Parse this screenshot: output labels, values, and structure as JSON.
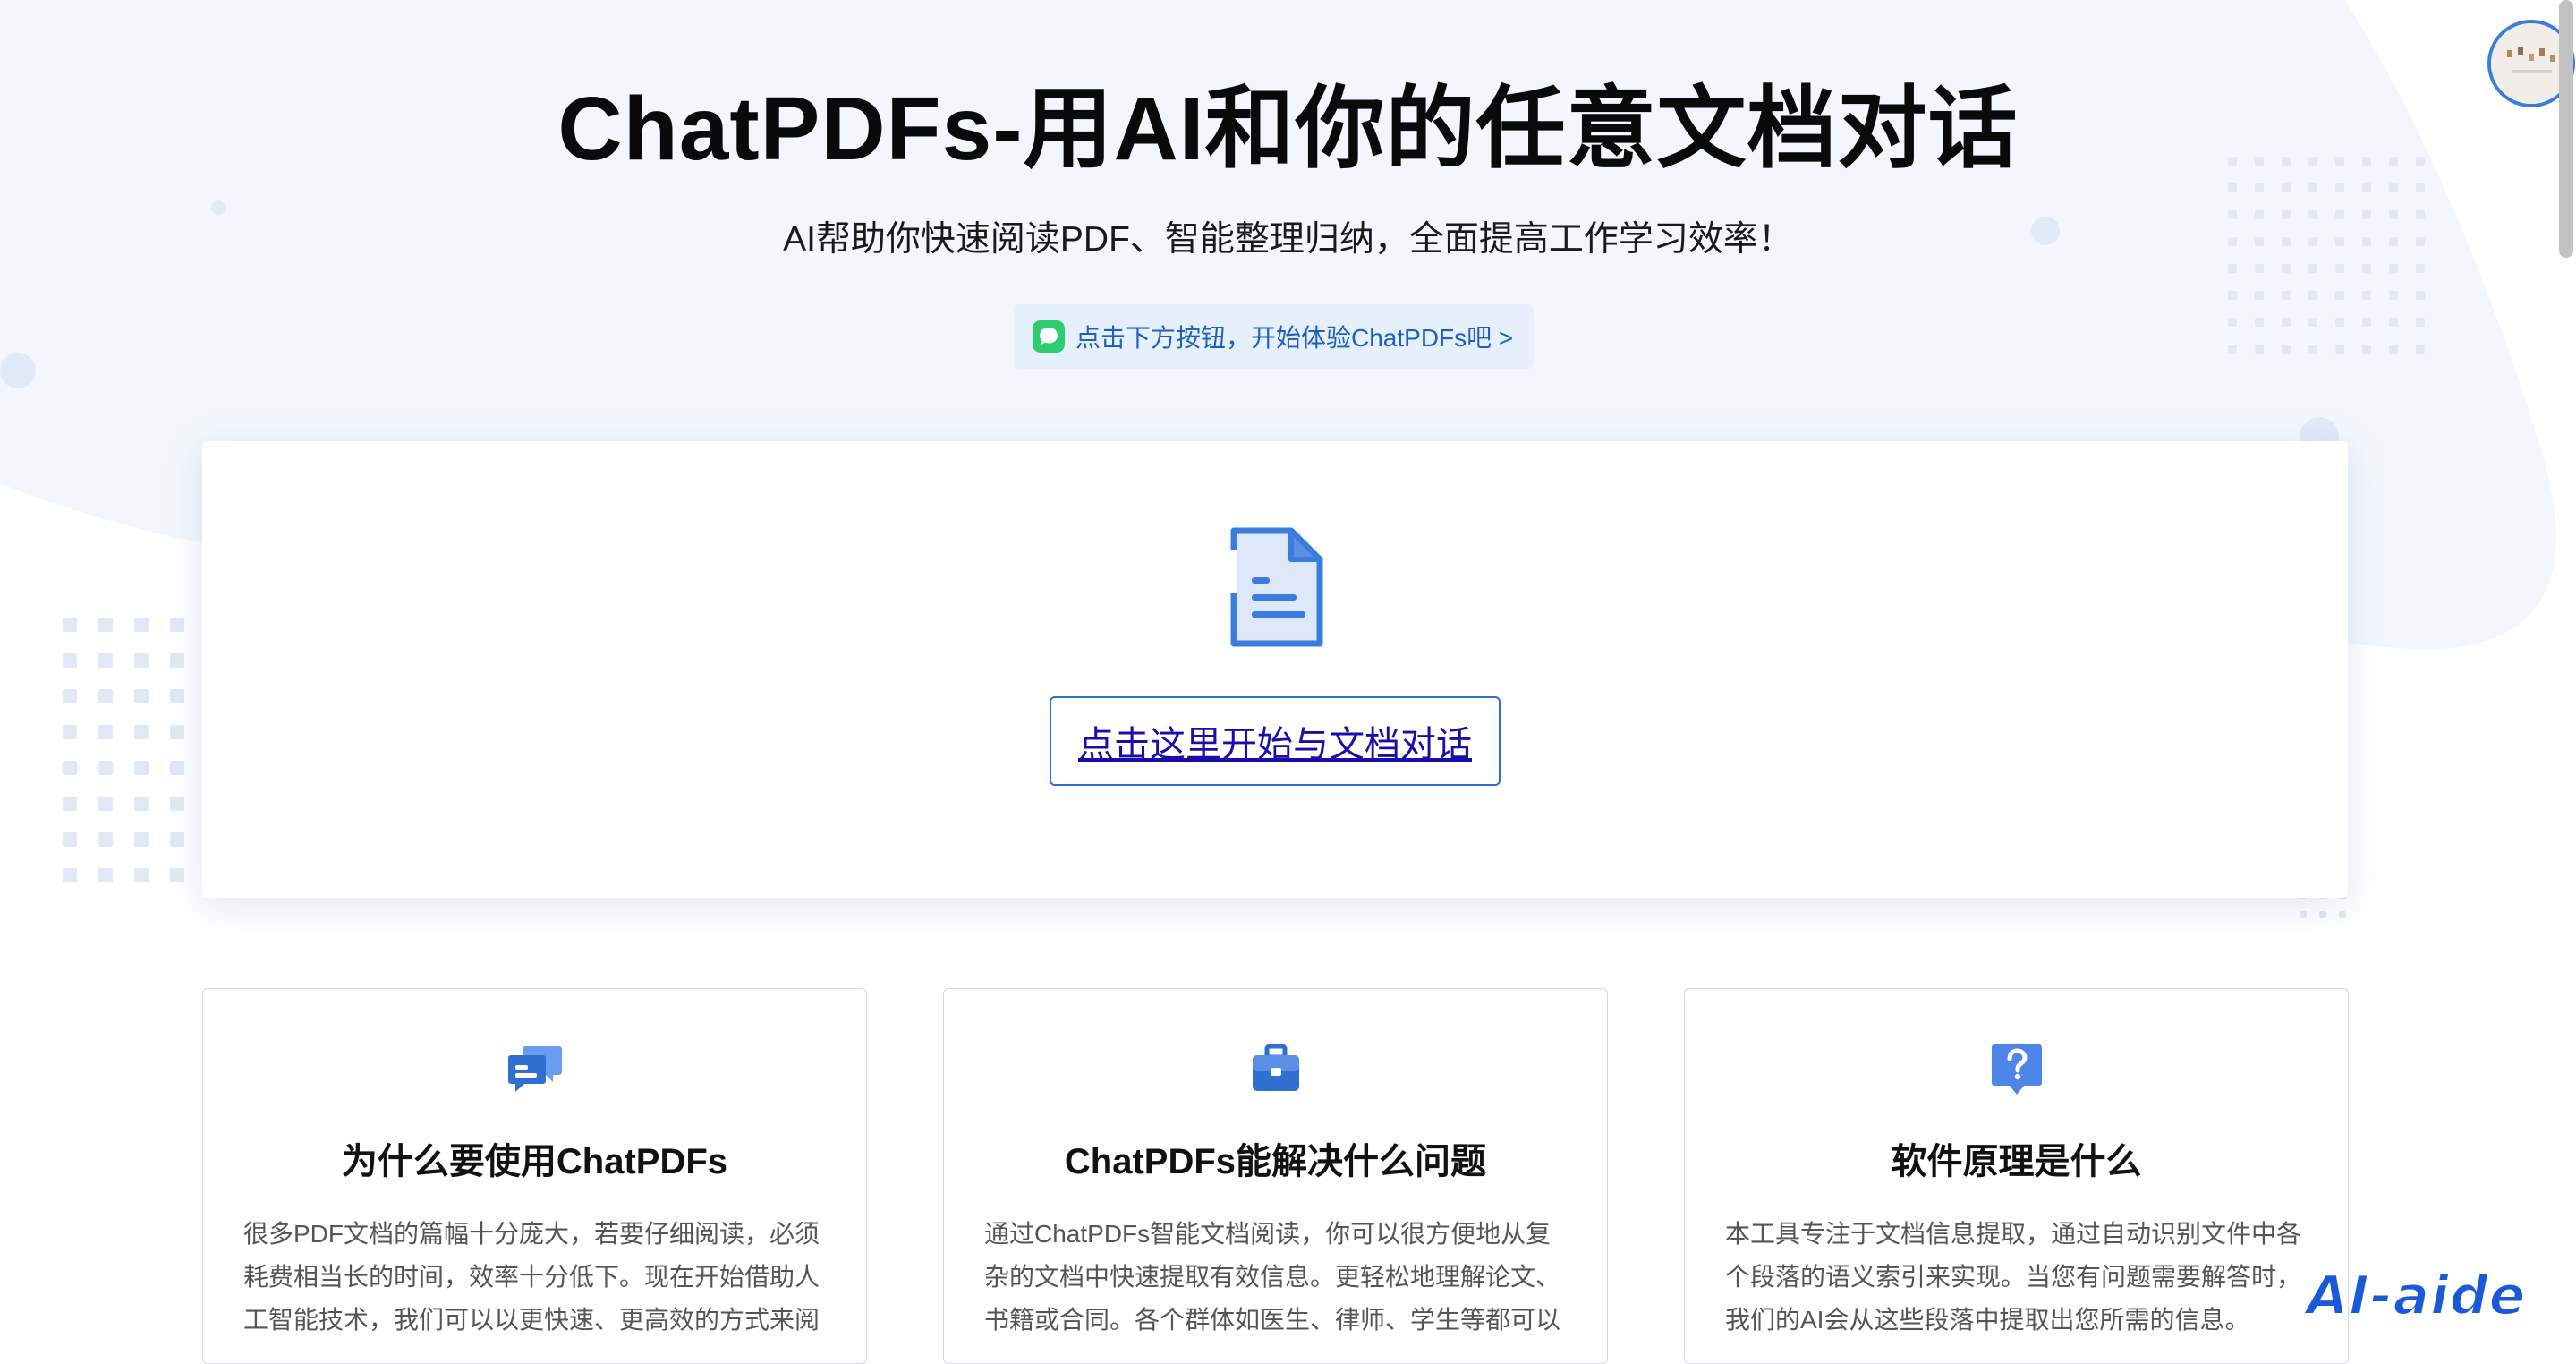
{
  "hero": {
    "title": "ChatPDFs-用AI和你的任意文档对话",
    "subtitle": "AI帮助你快速阅读PDF、智能整理归纳，全面提高工作学习效率！",
    "hint": "点击下方按钮，开始体验ChatPDFs吧 >"
  },
  "upload": {
    "button_label": "点击这里开始与文档对话"
  },
  "features": [
    {
      "icon": "chat-bubbles-icon",
      "title": "为什么要使用ChatPDFs",
      "lines": [
        "很多PDF文档的篇幅十分庞大，若要仔细阅读，必须",
        "耗费相当长的时间，效率十分低下。现在开始借助人",
        "工智能技术，我们可以以更快速、更高效的方式来阅"
      ]
    },
    {
      "icon": "briefcase-icon",
      "title": "ChatPDFs能解决什么问题",
      "lines": [
        "通过ChatPDFs智能文档阅读，你可以很方便地从复",
        "杂的文档中快速提取有效信息。更轻松地理解论文、",
        "书籍或合同。各个群体如医生、律师、学生等都可以"
      ]
    },
    {
      "icon": "question-icon",
      "title": "软件原理是什么",
      "lines": [
        "本工具专注于文档信息提取，通过自动识别文件中各",
        "个段落的语义索引来实现。当您有问题需要解答时，",
        "我们的AI会从这些段落中提取出您所需的信息。"
      ]
    }
  ],
  "watermark": "AI-aide",
  "colors": {
    "accent": "#2f6fd0",
    "link": "#1a0dab",
    "hint_bg": "#e6f0fd",
    "hint_text": "#1f5fbf",
    "icon_blue": "#3b7ddd",
    "chat_green": "#2ecc71"
  }
}
